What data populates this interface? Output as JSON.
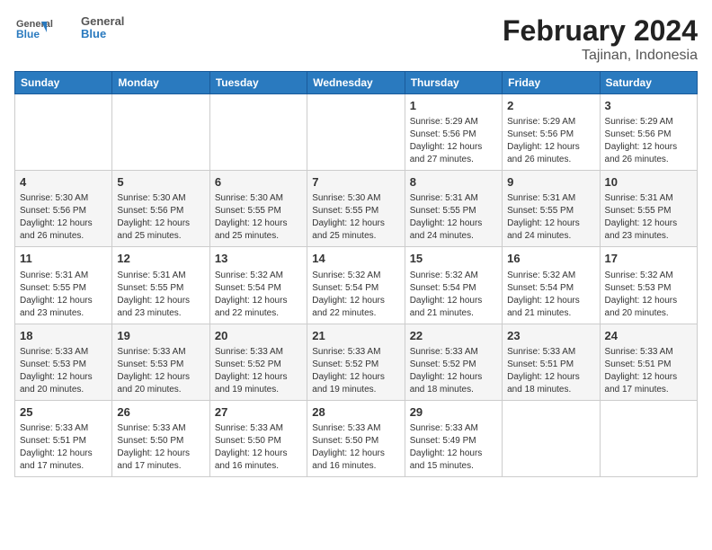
{
  "header": {
    "logo_line1": "General",
    "logo_line2": "Blue",
    "title": "February 2024",
    "subtitle": "Tajinan, Indonesia"
  },
  "weekdays": [
    "Sunday",
    "Monday",
    "Tuesday",
    "Wednesday",
    "Thursday",
    "Friday",
    "Saturday"
  ],
  "weeks": [
    [
      {
        "day": "",
        "info": ""
      },
      {
        "day": "",
        "info": ""
      },
      {
        "day": "",
        "info": ""
      },
      {
        "day": "",
        "info": ""
      },
      {
        "day": "1",
        "info": "Sunrise: 5:29 AM\nSunset: 5:56 PM\nDaylight: 12 hours and 27 minutes."
      },
      {
        "day": "2",
        "info": "Sunrise: 5:29 AM\nSunset: 5:56 PM\nDaylight: 12 hours and 26 minutes."
      },
      {
        "day": "3",
        "info": "Sunrise: 5:29 AM\nSunset: 5:56 PM\nDaylight: 12 hours and 26 minutes."
      }
    ],
    [
      {
        "day": "4",
        "info": "Sunrise: 5:30 AM\nSunset: 5:56 PM\nDaylight: 12 hours and 26 minutes."
      },
      {
        "day": "5",
        "info": "Sunrise: 5:30 AM\nSunset: 5:56 PM\nDaylight: 12 hours and 25 minutes."
      },
      {
        "day": "6",
        "info": "Sunrise: 5:30 AM\nSunset: 5:55 PM\nDaylight: 12 hours and 25 minutes."
      },
      {
        "day": "7",
        "info": "Sunrise: 5:30 AM\nSunset: 5:55 PM\nDaylight: 12 hours and 25 minutes."
      },
      {
        "day": "8",
        "info": "Sunrise: 5:31 AM\nSunset: 5:55 PM\nDaylight: 12 hours and 24 minutes."
      },
      {
        "day": "9",
        "info": "Sunrise: 5:31 AM\nSunset: 5:55 PM\nDaylight: 12 hours and 24 minutes."
      },
      {
        "day": "10",
        "info": "Sunrise: 5:31 AM\nSunset: 5:55 PM\nDaylight: 12 hours and 23 minutes."
      }
    ],
    [
      {
        "day": "11",
        "info": "Sunrise: 5:31 AM\nSunset: 5:55 PM\nDaylight: 12 hours and 23 minutes."
      },
      {
        "day": "12",
        "info": "Sunrise: 5:31 AM\nSunset: 5:55 PM\nDaylight: 12 hours and 23 minutes."
      },
      {
        "day": "13",
        "info": "Sunrise: 5:32 AM\nSunset: 5:54 PM\nDaylight: 12 hours and 22 minutes."
      },
      {
        "day": "14",
        "info": "Sunrise: 5:32 AM\nSunset: 5:54 PM\nDaylight: 12 hours and 22 minutes."
      },
      {
        "day": "15",
        "info": "Sunrise: 5:32 AM\nSunset: 5:54 PM\nDaylight: 12 hours and 21 minutes."
      },
      {
        "day": "16",
        "info": "Sunrise: 5:32 AM\nSunset: 5:54 PM\nDaylight: 12 hours and 21 minutes."
      },
      {
        "day": "17",
        "info": "Sunrise: 5:32 AM\nSunset: 5:53 PM\nDaylight: 12 hours and 20 minutes."
      }
    ],
    [
      {
        "day": "18",
        "info": "Sunrise: 5:33 AM\nSunset: 5:53 PM\nDaylight: 12 hours and 20 minutes."
      },
      {
        "day": "19",
        "info": "Sunrise: 5:33 AM\nSunset: 5:53 PM\nDaylight: 12 hours and 20 minutes."
      },
      {
        "day": "20",
        "info": "Sunrise: 5:33 AM\nSunset: 5:52 PM\nDaylight: 12 hours and 19 minutes."
      },
      {
        "day": "21",
        "info": "Sunrise: 5:33 AM\nSunset: 5:52 PM\nDaylight: 12 hours and 19 minutes."
      },
      {
        "day": "22",
        "info": "Sunrise: 5:33 AM\nSunset: 5:52 PM\nDaylight: 12 hours and 18 minutes."
      },
      {
        "day": "23",
        "info": "Sunrise: 5:33 AM\nSunset: 5:51 PM\nDaylight: 12 hours and 18 minutes."
      },
      {
        "day": "24",
        "info": "Sunrise: 5:33 AM\nSunset: 5:51 PM\nDaylight: 12 hours and 17 minutes."
      }
    ],
    [
      {
        "day": "25",
        "info": "Sunrise: 5:33 AM\nSunset: 5:51 PM\nDaylight: 12 hours and 17 minutes."
      },
      {
        "day": "26",
        "info": "Sunrise: 5:33 AM\nSunset: 5:50 PM\nDaylight: 12 hours and 17 minutes."
      },
      {
        "day": "27",
        "info": "Sunrise: 5:33 AM\nSunset: 5:50 PM\nDaylight: 12 hours and 16 minutes."
      },
      {
        "day": "28",
        "info": "Sunrise: 5:33 AM\nSunset: 5:50 PM\nDaylight: 12 hours and 16 minutes."
      },
      {
        "day": "29",
        "info": "Sunrise: 5:33 AM\nSunset: 5:49 PM\nDaylight: 12 hours and 15 minutes."
      },
      {
        "day": "",
        "info": ""
      },
      {
        "day": "",
        "info": ""
      }
    ]
  ]
}
